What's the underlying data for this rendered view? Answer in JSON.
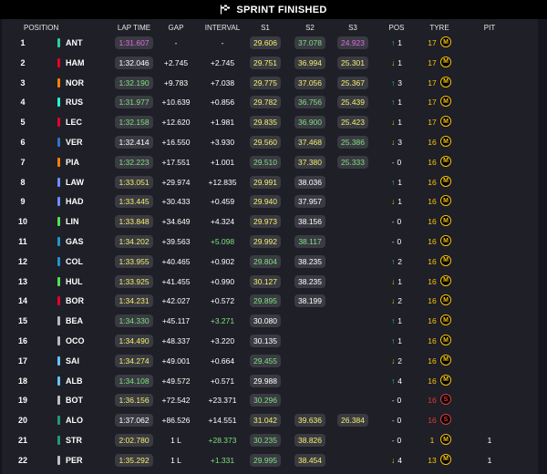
{
  "banner": {
    "title": "SPRINT FINISHED",
    "icon": "chequered-flag-icon"
  },
  "columns": {
    "position": "POSITION",
    "lap_time": "LAP TIME",
    "gap": "GAP",
    "interval": "INTERVAL",
    "s1": "S1",
    "s2": "S2",
    "s3": "S3",
    "pos": "POS",
    "tyre": "TYRE",
    "pit": "PIT"
  },
  "colors": {
    "green": "#7ee07e",
    "yellow": "#f3f06b",
    "purple": "#e16ae8",
    "up": "#33d17a",
    "down": "#f5c211",
    "tyre_medium": "#f5c211",
    "tyre_soft": "#e03a3a"
  },
  "rows": [
    {
      "p": "1",
      "d": "ANT",
      "tc": "#2ecc9a",
      "lap": "1:31.607",
      "lapc": "purple",
      "gap": "-",
      "int": "-",
      "intc": "white",
      "s1": "29.606",
      "s1c": "yellow",
      "s2": "37.078",
      "s2c": "green",
      "s3": "24.923",
      "s3c": "purple",
      "arrow": "↑",
      "dir": "up",
      "pch": "1",
      "age": "17",
      "tyre": "M",
      "pit": ""
    },
    {
      "p": "2",
      "d": "HAM",
      "tc": "#e8002d",
      "lap": "1:32.046",
      "lapc": "white",
      "gap": "+2.745",
      "int": "+2.745",
      "intc": "white",
      "s1": "29.751",
      "s1c": "yellow",
      "s2": "36.994",
      "s2c": "yellow",
      "s3": "25.301",
      "s3c": "yellow",
      "arrow": "↓",
      "dir": "down",
      "pch": "1",
      "age": "17",
      "tyre": "M",
      "pit": ""
    },
    {
      "p": "3",
      "d": "NOR",
      "tc": "#ff8000",
      "lap": "1:32.190",
      "lapc": "green",
      "gap": "+9.783",
      "int": "+7.038",
      "intc": "white",
      "s1": "29.775",
      "s1c": "yellow",
      "s2": "37.056",
      "s2c": "yellow",
      "s3": "25.367",
      "s3c": "yellow",
      "arrow": "↑",
      "dir": "up",
      "pch": "3",
      "age": "17",
      "tyre": "M",
      "pit": ""
    },
    {
      "p": "4",
      "d": "RUS",
      "tc": "#27f4d2",
      "lap": "1:31.977",
      "lapc": "green",
      "gap": "+10.639",
      "int": "+0.856",
      "intc": "white",
      "s1": "29.782",
      "s1c": "yellow",
      "s2": "36.756",
      "s2c": "green",
      "s3": "25.439",
      "s3c": "yellow",
      "arrow": "↑",
      "dir": "up",
      "pch": "1",
      "age": "17",
      "tyre": "M",
      "pit": ""
    },
    {
      "p": "5",
      "d": "LEC",
      "tc": "#e8002d",
      "lap": "1:32.158",
      "lapc": "green",
      "gap": "+12.620",
      "int": "+1.981",
      "intc": "white",
      "s1": "29.835",
      "s1c": "yellow",
      "s2": "36.900",
      "s2c": "green",
      "s3": "25.423",
      "s3c": "yellow",
      "arrow": "↓",
      "dir": "down",
      "pch": "1",
      "age": "17",
      "tyre": "M",
      "pit": ""
    },
    {
      "p": "6",
      "d": "VER",
      "tc": "#3671c6",
      "lap": "1:32.414",
      "lapc": "white",
      "gap": "+16.550",
      "int": "+3.930",
      "intc": "white",
      "s1": "29.560",
      "s1c": "yellow",
      "s2": "37.468",
      "s2c": "yellow",
      "s3": "25.386",
      "s3c": "green",
      "arrow": "↓",
      "dir": "down",
      "pch": "3",
      "age": "16",
      "tyre": "M",
      "pit": ""
    },
    {
      "p": "7",
      "d": "PIA",
      "tc": "#ff8000",
      "lap": "1:32.223",
      "lapc": "green",
      "gap": "+17.551",
      "int": "+1.001",
      "intc": "white",
      "s1": "29.510",
      "s1c": "green",
      "s2": "37.380",
      "s2c": "yellow",
      "s3": "25.333",
      "s3c": "green",
      "arrow": "-",
      "dir": "stay",
      "pch": "0",
      "age": "16",
      "tyre": "M",
      "pit": ""
    },
    {
      "p": "8",
      "d": "LAW",
      "tc": "#6692ff",
      "lap": "1:33.051",
      "lapc": "yellow",
      "gap": "+29.974",
      "int": "+12.835",
      "intc": "white",
      "s1": "29.991",
      "s1c": "yellow",
      "s2": "38.036",
      "s2c": "white",
      "s3": "",
      "s3c": "white",
      "arrow": "↑",
      "dir": "up",
      "pch": "1",
      "age": "16",
      "tyre": "M",
      "pit": ""
    },
    {
      "p": "9",
      "d": "HAD",
      "tc": "#6692ff",
      "lap": "1:33.445",
      "lapc": "yellow",
      "gap": "+30.433",
      "int": "+0.459",
      "intc": "white",
      "s1": "29.940",
      "s1c": "yellow",
      "s2": "37.957",
      "s2c": "white",
      "s3": "",
      "s3c": "white",
      "arrow": "↓",
      "dir": "down",
      "pch": "1",
      "age": "16",
      "tyre": "M",
      "pit": ""
    },
    {
      "p": "10",
      "d": "LIN",
      "tc": "#52e252",
      "lap": "1:33.848",
      "lapc": "yellow",
      "gap": "+34.649",
      "int": "+4.324",
      "intc": "white",
      "s1": "29.973",
      "s1c": "yellow",
      "s2": "38.156",
      "s2c": "white",
      "s3": "",
      "s3c": "white",
      "arrow": "-",
      "dir": "stay",
      "pch": "0",
      "age": "16",
      "tyre": "M",
      "pit": ""
    },
    {
      "p": "11",
      "d": "GAS",
      "tc": "#2293d1",
      "lap": "1:34.202",
      "lapc": "yellow",
      "gap": "+39.563",
      "int": "+5.098",
      "intc": "green",
      "s1": "29.992",
      "s1c": "yellow",
      "s2": "38.117",
      "s2c": "green",
      "s3": "",
      "s3c": "white",
      "arrow": "-",
      "dir": "stay",
      "pch": "0",
      "age": "16",
      "tyre": "M",
      "pit": ""
    },
    {
      "p": "12",
      "d": "COL",
      "tc": "#2293d1",
      "lap": "1:33.955",
      "lapc": "yellow",
      "gap": "+40.465",
      "int": "+0.902",
      "intc": "white",
      "s1": "29.804",
      "s1c": "green",
      "s2": "38.235",
      "s2c": "white",
      "s3": "",
      "s3c": "white",
      "arrow": "↑",
      "dir": "up",
      "pch": "2",
      "age": "16",
      "tyre": "M",
      "pit": ""
    },
    {
      "p": "13",
      "d": "HUL",
      "tc": "#52e252",
      "lap": "1:33.925",
      "lapc": "yellow",
      "gap": "+41.455",
      "int": "+0.990",
      "intc": "white",
      "s1": "30.127",
      "s1c": "yellow",
      "s2": "38.235",
      "s2c": "white",
      "s3": "",
      "s3c": "white",
      "arrow": "↓",
      "dir": "down",
      "pch": "1",
      "age": "16",
      "tyre": "M",
      "pit": ""
    },
    {
      "p": "14",
      "d": "BOR",
      "tc": "#e8002d",
      "lap": "1:34.231",
      "lapc": "yellow",
      "gap": "+42.027",
      "int": "+0.572",
      "intc": "white",
      "s1": "29.895",
      "s1c": "green",
      "s2": "38.199",
      "s2c": "white",
      "s3": "",
      "s3c": "white",
      "arrow": "↓",
      "dir": "down",
      "pch": "2",
      "age": "16",
      "tyre": "M",
      "pit": ""
    },
    {
      "p": "15",
      "d": "BEA",
      "tc": "#b6babd",
      "lap": "1:34.330",
      "lapc": "green",
      "gap": "+45.117",
      "int": "+3.271",
      "intc": "green",
      "s1": "30.080",
      "s1c": "white",
      "s2": "",
      "s2c": "white",
      "s3": "",
      "s3c": "white",
      "arrow": "↑",
      "dir": "up",
      "pch": "1",
      "age": "16",
      "tyre": "M",
      "pit": ""
    },
    {
      "p": "16",
      "d": "OCO",
      "tc": "#b6babd",
      "lap": "1:34.490",
      "lapc": "yellow",
      "gap": "+48.337",
      "int": "+3.220",
      "intc": "white",
      "s1": "30.135",
      "s1c": "white",
      "s2": "",
      "s2c": "white",
      "s3": "",
      "s3c": "white",
      "arrow": "↑",
      "dir": "up",
      "pch": "1",
      "age": "16",
      "tyre": "M",
      "pit": ""
    },
    {
      "p": "17",
      "d": "SAI",
      "tc": "#64c4ff",
      "lap": "1:34.274",
      "lapc": "yellow",
      "gap": "+49.001",
      "int": "+0.664",
      "intc": "white",
      "s1": "29.455",
      "s1c": "green",
      "s2": "",
      "s2c": "white",
      "s3": "",
      "s3c": "white",
      "arrow": "↓",
      "dir": "down",
      "pch": "2",
      "age": "16",
      "tyre": "M",
      "pit": ""
    },
    {
      "p": "18",
      "d": "ALB",
      "tc": "#64c4ff",
      "lap": "1:34.108",
      "lapc": "green",
      "gap": "+49.572",
      "int": "+0.571",
      "intc": "white",
      "s1": "29.988",
      "s1c": "white",
      "s2": "",
      "s2c": "white",
      "s3": "",
      "s3c": "white",
      "arrow": "↑",
      "dir": "up",
      "pch": "4",
      "age": "16",
      "tyre": "M",
      "pit": ""
    },
    {
      "p": "19",
      "d": "BOT",
      "tc": "#c0c0c0",
      "lap": "1:36.156",
      "lapc": "yellow",
      "gap": "+72.542",
      "int": "+23.371",
      "intc": "white",
      "s1": "30.296",
      "s1c": "green",
      "s2": "",
      "s2c": "white",
      "s3": "",
      "s3c": "white",
      "arrow": "-",
      "dir": "stay",
      "pch": "0",
      "age": "16",
      "tyre": "S",
      "pit": ""
    },
    {
      "p": "20",
      "d": "ALO",
      "tc": "#229971",
      "lap": "1:37.062",
      "lapc": "white",
      "gap": "+86.526",
      "int": "+14.551",
      "intc": "white",
      "s1": "31.042",
      "s1c": "yellow",
      "s2": "39.636",
      "s2c": "yellow",
      "s3": "26.384",
      "s3c": "yellow",
      "arrow": "-",
      "dir": "stay",
      "pch": "0",
      "age": "16",
      "tyre": "S",
      "pit": ""
    },
    {
      "p": "21",
      "d": "STR",
      "tc": "#229971",
      "lap": "2:02.780",
      "lapc": "yellow",
      "gap": "1 L",
      "int": "+28.373",
      "intc": "green",
      "s1": "30.235",
      "s1c": "green",
      "s2": "38.826",
      "s2c": "yellow",
      "s3": "",
      "s3c": "white",
      "arrow": "-",
      "dir": "stay",
      "pch": "0",
      "age": "1",
      "tyre": "M",
      "pit": "1"
    },
    {
      "p": "22",
      "d": "PER",
      "tc": "#c0c0c0",
      "lap": "1:35.292",
      "lapc": "yellow",
      "gap": "1 L",
      "int": "+1.331",
      "intc": "green",
      "s1": "29.995",
      "s1c": "green",
      "s2": "38.454",
      "s2c": "yellow",
      "s3": "",
      "s3c": "white",
      "arrow": "↓",
      "dir": "down",
      "pch": "4",
      "age": "13",
      "tyre": "M",
      "pit": "1"
    }
  ]
}
